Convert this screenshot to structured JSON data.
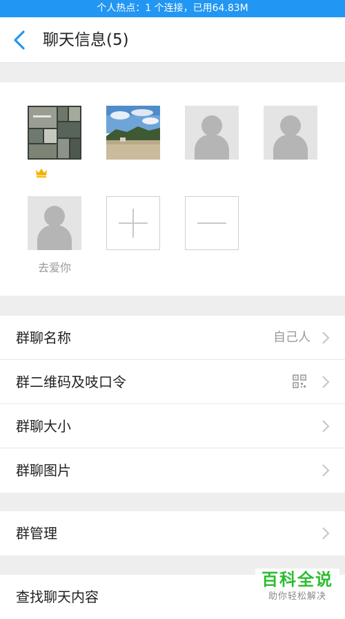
{
  "status_bar": {
    "text": "个人热点：1 个连接，已用64.83M"
  },
  "nav": {
    "title": "聊天信息(5)"
  },
  "members": [
    {
      "name": "",
      "avatar": "photo-collage",
      "is_owner": true
    },
    {
      "name": "",
      "avatar": "landscape-photo",
      "is_owner": false
    },
    {
      "name": "",
      "avatar": "default-avatar",
      "is_owner": false
    },
    {
      "name": "",
      "avatar": "default-avatar",
      "is_owner": false
    },
    {
      "name": "去爱你",
      "avatar": "default-avatar",
      "is_owner": false
    }
  ],
  "member_actions": {
    "add": "plus-icon",
    "remove": "minus-icon"
  },
  "settings": {
    "group_name": {
      "label": "群聊名称",
      "value": "自己人"
    },
    "qr_code": {
      "label": "群二维码及吱口令",
      "icon": "qr-code-icon"
    },
    "group_size": {
      "label": "群聊大小"
    },
    "group_images": {
      "label": "群聊图片"
    },
    "group_manage": {
      "label": "群管理"
    },
    "search_history": {
      "label": "查找聊天内容"
    }
  },
  "watermark": {
    "title": "百科全说",
    "subtitle": "助你轻松解决"
  },
  "colors": {
    "status_bar": "#2196f3",
    "accent": "#2196f3",
    "owner_crown": "#f5b300",
    "watermark_green": "#2bbd2f"
  }
}
